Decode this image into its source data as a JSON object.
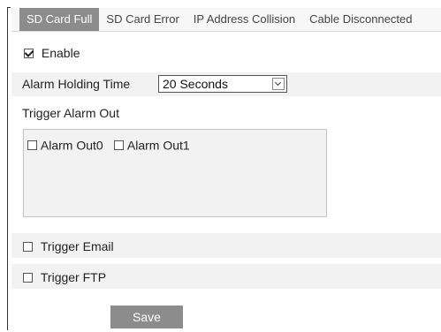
{
  "tabs": [
    {
      "label": "SD Card Full",
      "active": true
    },
    {
      "label": "SD Card Error",
      "active": false
    },
    {
      "label": "IP Address Collision",
      "active": false
    },
    {
      "label": "Cable Disconnected",
      "active": false
    }
  ],
  "enable": {
    "label": "Enable",
    "checked": true
  },
  "alarm_holding": {
    "label": "Alarm Holding Time",
    "value": "20 Seconds"
  },
  "trigger_alarm_out": {
    "label": "Trigger Alarm Out",
    "outputs": [
      {
        "label": "Alarm Out0",
        "checked": false
      },
      {
        "label": "Alarm Out1",
        "checked": false
      }
    ]
  },
  "trigger_email": {
    "label": "Trigger Email",
    "checked": false
  },
  "trigger_ftp": {
    "label": "Trigger FTP",
    "checked": false
  },
  "save_label": "Save",
  "colors": {
    "tab_active": "#8c8c8c",
    "row_shade": "#f2f2f2",
    "button": "#8c8c8c"
  }
}
